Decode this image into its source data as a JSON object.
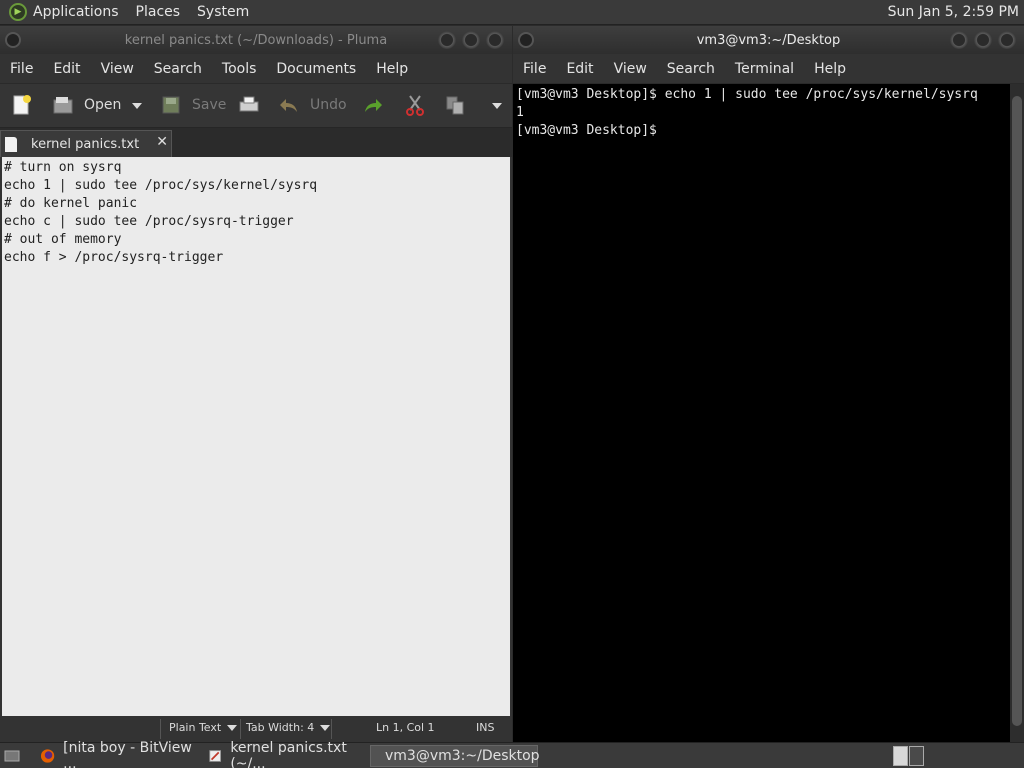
{
  "top_panel": {
    "menus": [
      "Applications",
      "Places",
      "System"
    ],
    "clock": "Sun Jan  5,  2:59 PM"
  },
  "pluma": {
    "title": "kernel panics.txt (~/Downloads) - Pluma",
    "menu": [
      "File",
      "Edit",
      "View",
      "Search",
      "Tools",
      "Documents",
      "Help"
    ],
    "toolbar": {
      "open": "Open",
      "save": "Save",
      "undo": "Undo"
    },
    "tab_label": "kernel panics.txt",
    "tab_close": "✕",
    "lines": [
      "# turn on sysrq",
      "echo 1 | sudo tee /proc/sys/kernel/sysrq",
      "# do kernel panic",
      "echo c | sudo tee /proc/sysrq-trigger",
      "# out of memory",
      "echo f > /proc/sysrq-trigger"
    ],
    "status": {
      "syntax": "Plain Text",
      "tab_width": "Tab Width:  4",
      "position": "Ln 1, Col 1",
      "mode": "INS"
    }
  },
  "terminal": {
    "title": "vm3@vm3:~/Desktop",
    "menu": [
      "File",
      "Edit",
      "View",
      "Search",
      "Terminal",
      "Help"
    ],
    "lines": [
      "[vm3@vm3 Desktop]$ echo 1 | sudo tee /proc/sys/kernel/sysrq",
      "1",
      "[vm3@vm3 Desktop]$ "
    ]
  },
  "taskbar": {
    "tasks": [
      "[nita boy - BitView ...",
      "kernel panics.txt (~/...",
      "vm3@vm3:~/Desktop"
    ]
  },
  "colors": {
    "editor_bg": "#ebebeb",
    "terminal_bg": "#000000",
    "panel_bg": "#3a3a3a",
    "redo_green": "#5aa02c",
    "cut_red": "#d03030"
  }
}
